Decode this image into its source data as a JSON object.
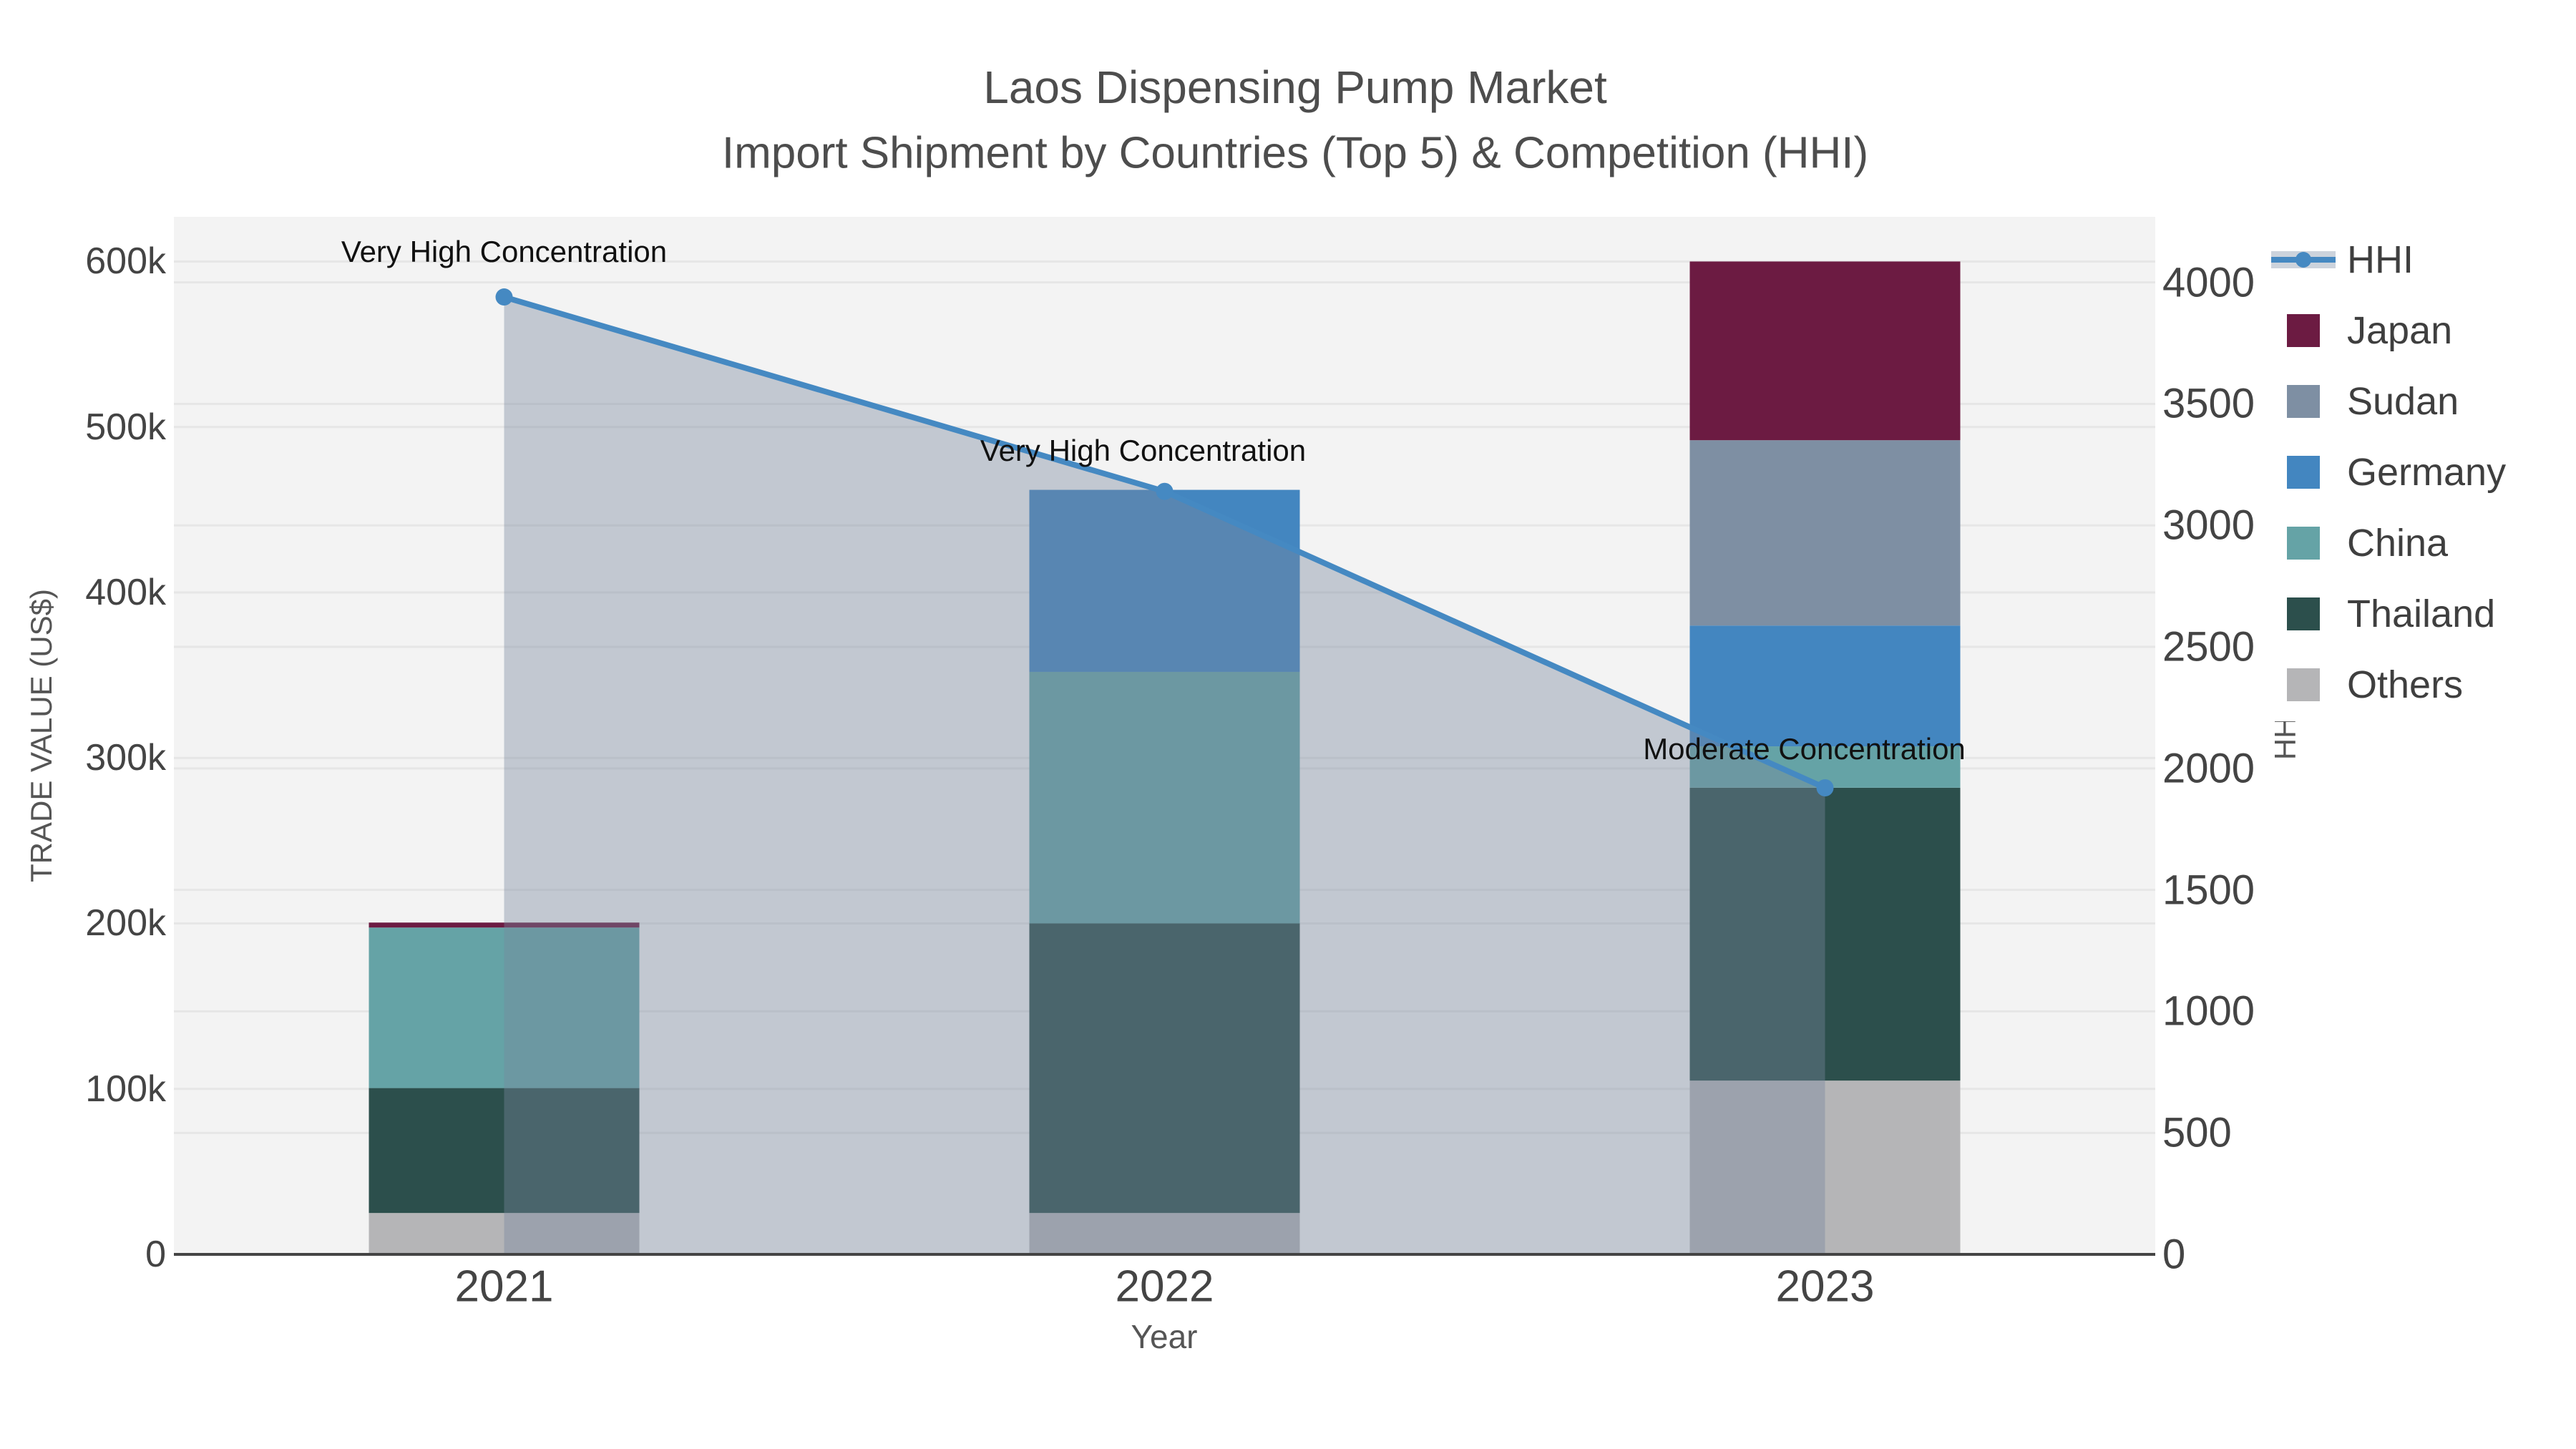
{
  "title": {
    "line1": "Laos Dispensing Pump Market",
    "line2": "Import Shipment by Countries (Top 5) & Competition (HHI)"
  },
  "axes": {
    "x": {
      "title": "Year",
      "categories": [
        "2021",
        "2022",
        "2023"
      ]
    },
    "left": {
      "title": "TRADE VALUE (US$)",
      "ticks": [
        {
          "value": 0,
          "label": "0"
        },
        {
          "value": 100000,
          "label": "100k"
        },
        {
          "value": 200000,
          "label": "200k"
        },
        {
          "value": 300000,
          "label": "300k"
        },
        {
          "value": 400000,
          "label": "400k"
        },
        {
          "value": 500000,
          "label": "500k"
        },
        {
          "value": 600000,
          "label": "600k"
        }
      ],
      "range": [
        0,
        627000
      ]
    },
    "right": {
      "title": "HHI",
      "ticks": [
        {
          "value": 0,
          "label": "0"
        },
        {
          "value": 500,
          "label": "500"
        },
        {
          "value": 1000,
          "label": "1000"
        },
        {
          "value": 1500,
          "label": "1500"
        },
        {
          "value": 2000,
          "label": "2000"
        },
        {
          "value": 2500,
          "label": "2500"
        },
        {
          "value": 3000,
          "label": "3000"
        },
        {
          "value": 3500,
          "label": "3500"
        },
        {
          "value": 4000,
          "label": "4000"
        }
      ],
      "range": [
        0,
        4270
      ]
    }
  },
  "legend": {
    "items": [
      {
        "label": "HHI",
        "type": "line",
        "color": "#4589c2",
        "band_color": "#ccd3dc"
      },
      {
        "label": "Japan",
        "type": "swatch",
        "color": "#6c1b42"
      },
      {
        "label": "Sudan",
        "type": "swatch",
        "color": "#7e8fa3"
      },
      {
        "label": "Germany",
        "type": "swatch",
        "color": "#4386c0"
      },
      {
        "label": "China",
        "type": "swatch",
        "color": "#65a3a6"
      },
      {
        "label": "Thailand",
        "type": "swatch",
        "color": "#2c4f4c"
      },
      {
        "label": "Others",
        "type": "swatch",
        "color": "#b5b5b7"
      }
    ]
  },
  "annotations": [
    {
      "text": "Very High Concentration",
      "point_index": 0,
      "dx": 0,
      "dy": -63
    },
    {
      "text": "Very High Concentration",
      "point_index": 1,
      "dx": -30,
      "dy": -57
    },
    {
      "text": "Moderate Concentration",
      "point_index": 2,
      "dx": -29,
      "dy": -54
    }
  ],
  "chart_data": {
    "type": "bar",
    "subtype": "stacked-bar-with-line",
    "title": "Laos Dispensing Pump Market — Import Shipment by Countries (Top 5) & Competition (HHI)",
    "categories": [
      "2021",
      "2022",
      "2023"
    ],
    "series": [
      {
        "name": "Japan",
        "color": "#6c1b42",
        "axis": "left",
        "values": [
          3000,
          0,
          108000
        ]
      },
      {
        "name": "Sudan",
        "color": "#7e8fa3",
        "axis": "left",
        "values": [
          0,
          0,
          112000
        ]
      },
      {
        "name": "Germany",
        "color": "#4386c0",
        "axis": "left",
        "values": [
          0,
          110000,
          73000
        ]
      },
      {
        "name": "China",
        "color": "#65a3a6",
        "axis": "left",
        "values": [
          97000,
          152000,
          25000
        ]
      },
      {
        "name": "Thailand",
        "color": "#2c4f4c",
        "axis": "left",
        "values": [
          75500,
          175000,
          177000
        ]
      },
      {
        "name": "Others",
        "color": "#b5b5b7",
        "axis": "left",
        "values": [
          25000,
          25000,
          105000
        ]
      }
    ],
    "stack_order_bottom_to_top": [
      "Others",
      "Thailand",
      "China",
      "Germany",
      "Sudan",
      "Japan"
    ],
    "line_series": {
      "name": "HHI",
      "axis": "right",
      "color": "#4589c2",
      "area_fill": "rgba(120,135,158,0.4)",
      "values": [
        3940,
        3140,
        1920
      ]
    },
    "xlabel": "Year",
    "ylabel_left": "TRADE VALUE (US$)",
    "ylabel_right": "HHI",
    "ylim_left": [
      0,
      627000
    ],
    "ylim_right": [
      0,
      4270
    ],
    "grid": true,
    "legend_position": "top-right",
    "plot_background": "#f3f3f3"
  },
  "colors": {
    "plot_bg": "#f3f3f3",
    "grid": "#e6e6e6",
    "axis_line": "#444444",
    "tick_text": "#444444",
    "title_text": "#4d4d4d",
    "annotation_text": "#111111"
  }
}
